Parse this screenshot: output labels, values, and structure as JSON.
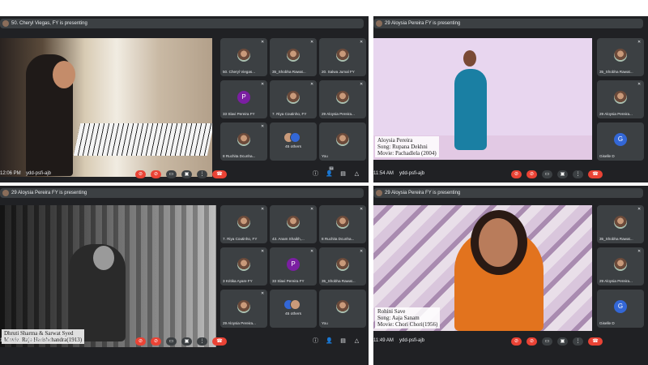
{
  "panels": [
    {
      "presenting": "50. Cheryl Viegas, FY is presenting",
      "caption": [],
      "tiles": [
        {
          "name": "50. Cheryl Viegas...",
          "kind": "photo"
        },
        {
          "name": "35_Shobha Rawat...",
          "kind": "photo"
        },
        {
          "name": "20. Salwa Jumal FY",
          "kind": "photo"
        },
        {
          "name": "33 Slavi Pereira FY",
          "kind": "letter",
          "letter": "P"
        },
        {
          "name": "7. Riya Coutinho, FY",
          "kind": "photo"
        },
        {
          "name": "29 Aloysia Pereira...",
          "kind": "photo"
        },
        {
          "name": "8 Ruchita Dcunha...",
          "kind": "photo"
        },
        {
          "name": "",
          "kind": "others",
          "label": "45 others"
        },
        {
          "name": "You",
          "kind": "photo"
        }
      ],
      "time": "12:06 PM",
      "meeting_code": "ydd-psfi-ajb",
      "people_count": "54"
    },
    {
      "presenting": "29 Aloysia Pereira FY is presenting",
      "caption": [
        "Aloysia Pereira",
        "Song: Rupana Dekhni",
        "Movie: Pachadlela (2004)"
      ],
      "tiles": [
        {
          "name": "35_Shobha Rawat...",
          "kind": "photo"
        },
        {
          "name": "29 Aloysia Pereira...",
          "kind": "photo"
        },
        {
          "name": "Giselle D",
          "kind": "letter",
          "letter": "G"
        }
      ],
      "time": "11:54 AM",
      "meeting_code": "ydd-psfi-ajb",
      "people_count": ""
    },
    {
      "presenting": "29 Aloysia Pereira FY is presenting",
      "caption": [
        "Dhruti Sharma & Sarwat Syed",
        "Movie: Raja Harishchandra(1913)"
      ],
      "tiles": [
        {
          "name": "7. Riya Coutinho, FY",
          "kind": "photo"
        },
        {
          "name": "43. Anam Shaikh,...",
          "kind": "photo"
        },
        {
          "name": "8 Ruchita Dcunha...",
          "kind": "photo"
        },
        {
          "name": "3 Kritika Ayare FY",
          "kind": "photo"
        },
        {
          "name": "33 Slavi Pereira FY",
          "kind": "letter",
          "letter": "P"
        },
        {
          "name": "35_Shobha Rawat...",
          "kind": "photo"
        },
        {
          "name": "29 Aloysia Pereira...",
          "kind": "photo"
        },
        {
          "name": "",
          "kind": "others",
          "label": "45 others"
        },
        {
          "name": "You",
          "kind": "photo"
        }
      ],
      "time": "11:40 AM",
      "meeting_code": "ydd-psfi-ajb",
      "people_count": ""
    },
    {
      "presenting": "29 Aloysia Pereira FY is presenting",
      "caption": [
        "Rohini Save",
        "Song: Aaja Sanam",
        "Movie: Chori Chori(1956)"
      ],
      "tiles": [
        {
          "name": "35_Shobha Rawat...",
          "kind": "photo"
        },
        {
          "name": "29 Aloysia Pereira...",
          "kind": "photo"
        },
        {
          "name": "Giselle D",
          "kind": "letter",
          "letter": "G"
        }
      ],
      "time": "11:49 AM",
      "meeting_code": "ydd-psfi-ajb",
      "people_count": ""
    }
  ],
  "colors": {
    "bg": "#202124",
    "tile": "#3c4043",
    "red": "#ea4335",
    "text": "#e8eaed"
  },
  "icons": [
    "mic-off-icon",
    "camera-off-icon",
    "captions-icon",
    "present-icon",
    "more-icon",
    "end-call-icon",
    "info-icon",
    "people-icon",
    "chat-icon",
    "activities-icon"
  ]
}
